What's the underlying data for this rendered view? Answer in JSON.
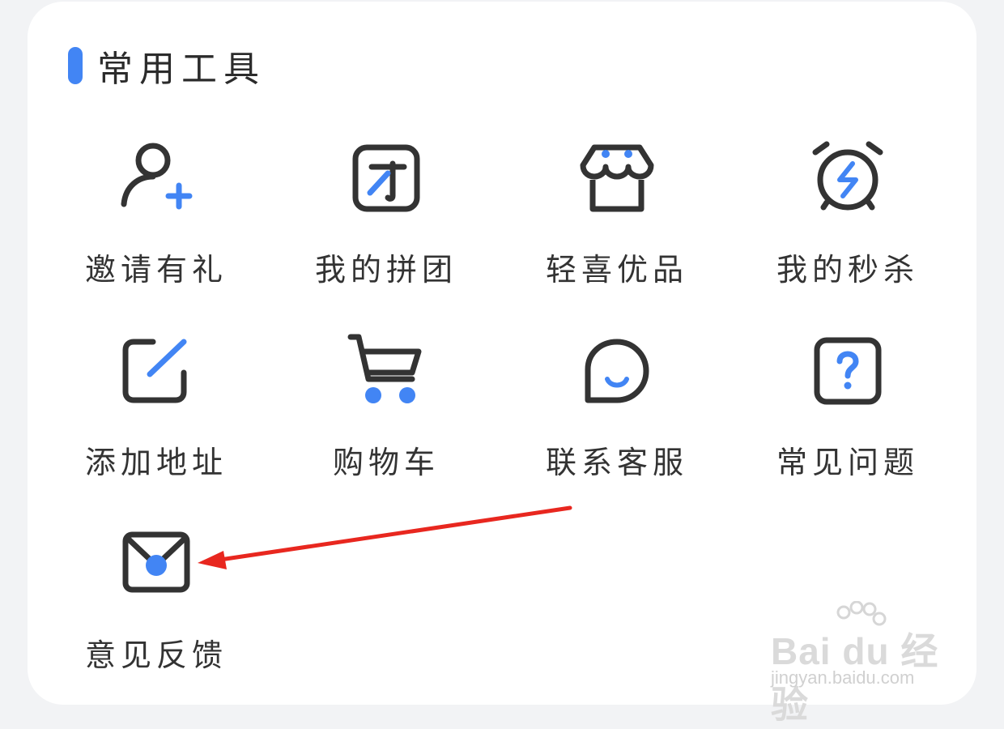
{
  "section": {
    "title": "常用工具"
  },
  "tools": [
    {
      "label": "邀请有礼",
      "icon": "invite-user-icon"
    },
    {
      "label": "我的拼团",
      "icon": "group-buy-icon"
    },
    {
      "label": "轻喜优品",
      "icon": "store-icon"
    },
    {
      "label": "我的秒杀",
      "icon": "alarm-clock-icon"
    },
    {
      "label": "添加地址",
      "icon": "edit-icon"
    },
    {
      "label": "购物车",
      "icon": "shopping-cart-icon"
    },
    {
      "label": "联系客服",
      "icon": "chat-bubble-icon"
    },
    {
      "label": "常见问题",
      "icon": "help-icon"
    },
    {
      "label": "意见反馈",
      "icon": "mail-icon"
    }
  ],
  "colors": {
    "accent": "#4285f4",
    "icon_stroke": "#333333",
    "annotation_arrow": "#e8271f"
  },
  "watermark": {
    "brand": "Bai du 经验",
    "url": "jingyan.baidu.com"
  }
}
